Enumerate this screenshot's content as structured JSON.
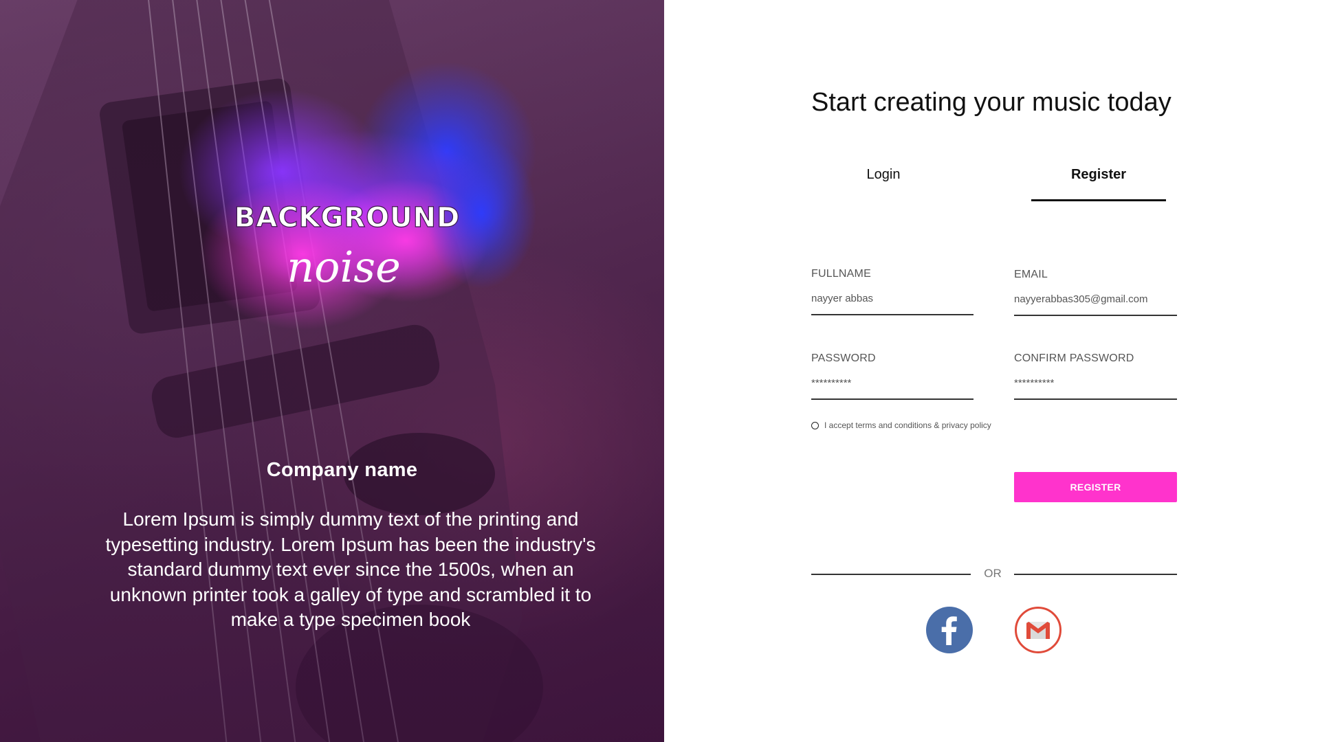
{
  "hero": {
    "logo": {
      "line1": "BACKGROUND",
      "line2": "noise"
    },
    "company_name": "Company name",
    "description": "Lorem Ipsum is simply dummy text of the printing and typesetting industry. Lorem Ipsum has been the industry's standard dummy text ever since the 1500s, when an unknown printer took a galley of type and scrambled it to make a type specimen book"
  },
  "form": {
    "title": "Start creating your music today",
    "tabs": [
      {
        "label": "Login",
        "active": false
      },
      {
        "label": "Register",
        "active": true
      }
    ],
    "fields": {
      "fullname": {
        "label": "FULLNAME",
        "value": "nayyer abbas"
      },
      "email": {
        "label": "EMAIL",
        "value": "nayyerabbas305@gmail.com"
      },
      "password": {
        "label": "PASSWORD",
        "value": "**********"
      },
      "confirm_password": {
        "label": "CONFIRM PASSWORD",
        "value": "**********"
      }
    },
    "terms_label": "I accept terms and conditions & privacy policy",
    "register_button": "REGISTER",
    "or_label": "OR",
    "social": {
      "facebook_icon": "facebook-icon",
      "gmail_icon": "gmail-icon"
    }
  },
  "colors": {
    "accent": "#ff33cc",
    "facebook": "#4a6ea9",
    "gmail_red": "#e04b3a",
    "hero_purple": "#5a3458"
  }
}
